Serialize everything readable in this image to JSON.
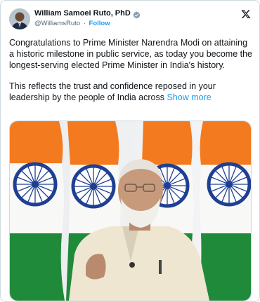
{
  "tweet": {
    "author_name": "William Samoei Ruto, PhD",
    "handle": "@WilliamsRuto",
    "separator": "·",
    "follow_label": "Follow",
    "paragraph1": "Congratulations to Prime Minister Narendra Modi on attaining a historic milestone in public service, as today you become the longest-serving elected Prime Minister in India's history.",
    "paragraph2": "This reflects the trust and confidence reposed in your leadership by the people of India across",
    "show_more_label": "Show more"
  },
  "colors": {
    "accent": "#1d9bf0",
    "text": "#0f1419",
    "secondary_text": "#536471",
    "saffron": "#f47a1f",
    "green": "#1f8a3a",
    "chakra_blue": "#1f3f93"
  },
  "icons": {
    "verified": "verified-badge-icon",
    "logo": "x-logo-icon"
  }
}
